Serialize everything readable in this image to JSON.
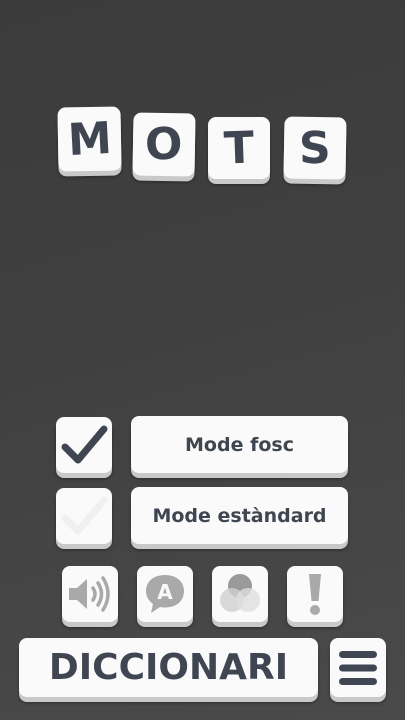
{
  "logo": {
    "letters": [
      "M",
      "O",
      "T",
      "S"
    ]
  },
  "modes": {
    "dark": {
      "label": "Mode fosc",
      "checked": true
    },
    "standard": {
      "label": "Mode estàndard",
      "checked": false
    }
  },
  "toolbar": {
    "icons": [
      "speaker-icon",
      "speech-bubble-a-icon",
      "color-blend-icon",
      "exclamation-icon"
    ],
    "bubble_letter": "A",
    "exclamation_glyph": "!"
  },
  "footer": {
    "dictionary_label": "DICCIONARI",
    "menu_icon": "hamburger-menu-icon"
  },
  "colors": {
    "tile": "#fafafa",
    "text": "#3f4651",
    "icon_gray": "#a9a9a9",
    "check_active": "#3f4651",
    "check_inactive": "#f0f0f0"
  }
}
